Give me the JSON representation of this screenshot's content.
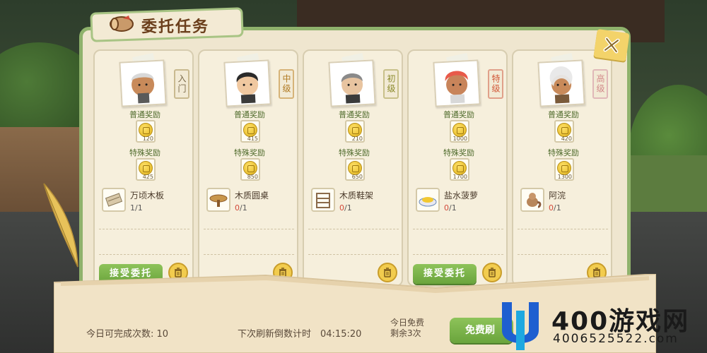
{
  "title": "委托任务",
  "cards": [
    {
      "rank": "入门",
      "rank_class": "",
      "normal_label": "普通奖励",
      "normal_value": "120",
      "special_label": "特殊奖励",
      "special_value": "425",
      "item_name": "万顷木板",
      "item_have": "1",
      "item_need": "/1",
      "item_complete": true,
      "item_icon": "wooden-plank-icon",
      "has_accept": true,
      "accept_label": "接受委托"
    },
    {
      "rank": "中级",
      "rank_class": "mid",
      "normal_label": "普通奖励",
      "normal_value": "415",
      "special_label": "特殊奖励",
      "special_value": "850",
      "item_name": "木质圆桌",
      "item_have": "0",
      "item_need": "/1",
      "item_complete": false,
      "item_icon": "round-table-icon",
      "has_accept": false,
      "accept_label": ""
    },
    {
      "rank": "初级",
      "rank_class": "beg",
      "normal_label": "普通奖励",
      "normal_value": "210",
      "special_label": "特殊奖励",
      "special_value": "650",
      "item_name": "木质鞋架",
      "item_have": "0",
      "item_need": "/1",
      "item_complete": false,
      "item_icon": "shoe-rack-icon",
      "has_accept": false,
      "accept_label": ""
    },
    {
      "rank": "特级",
      "rank_class": "sp",
      "normal_label": "普通奖励",
      "normal_value": "1000",
      "special_label": "特殊奖励",
      "special_value": "1700",
      "item_name": "盐水菠萝",
      "item_have": "0",
      "item_need": "/1",
      "item_complete": false,
      "item_icon": "pineapple-plate-icon",
      "has_accept": true,
      "accept_label": "接受委托"
    },
    {
      "rank": "高级",
      "rank_class": "hi",
      "normal_label": "普通奖励",
      "normal_value": "420",
      "special_label": "特殊奖励",
      "special_value": "1300",
      "item_name": "阿浣",
      "item_have": "0",
      "item_need": "/1",
      "item_complete": false,
      "item_icon": "raccoon-icon",
      "has_accept": false,
      "accept_label": ""
    }
  ],
  "footer": {
    "today_label": "今日可完成次数: 10",
    "refresh_label": "下次刷新倒数计时　04:15:20",
    "free_line1": "今日免费",
    "free_line2": "剩余3次",
    "free_button": "免费刷"
  },
  "watermark": {
    "big": "400游戏网",
    "small": "4006525522.com"
  },
  "colors": {
    "panel_border": "#8fb26c",
    "accept_green": "#6aa43c",
    "coin_gold": "#e0b21a",
    "title_brown": "#6b3f1c"
  }
}
